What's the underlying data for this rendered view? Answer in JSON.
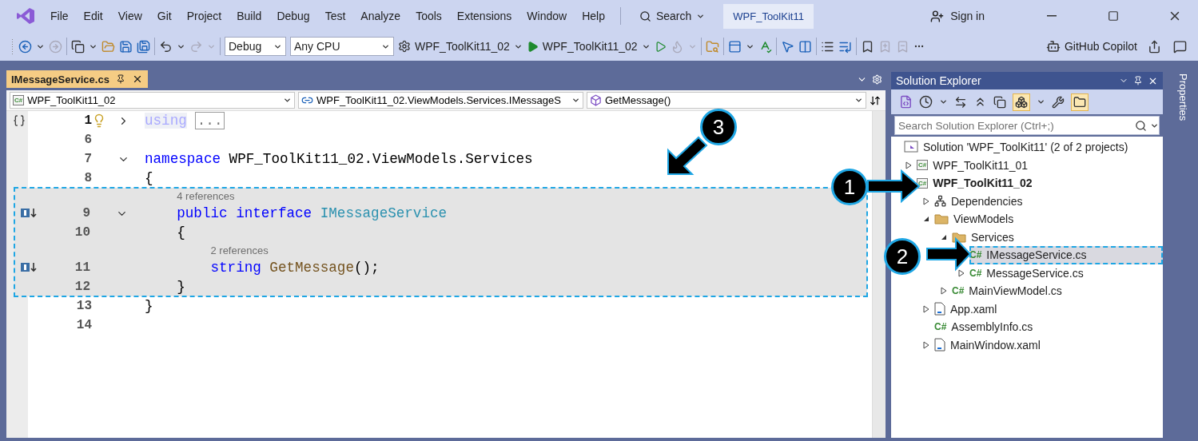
{
  "menu": {
    "items": [
      "File",
      "Edit",
      "View",
      "Git",
      "Project",
      "Build",
      "Debug",
      "Test",
      "Analyze",
      "Tools",
      "Extensions",
      "Window",
      "Help"
    ],
    "search": "Search",
    "solution_name": "WPF_ToolKit11",
    "sign_in": "Sign in"
  },
  "toolbar": {
    "configuration": "Debug",
    "platform": "Any CPU",
    "startup_project": "WPF_ToolKit11_02",
    "run_target": "WPF_ToolKit11_02",
    "copilot": "GitHub Copilot"
  },
  "editor": {
    "tabs": [
      {
        "label": "IMessageService.cs",
        "selected": true
      }
    ],
    "nav": [
      {
        "kind": "project",
        "icon_text": "C#",
        "label": "WPF_ToolKit11_02"
      },
      {
        "kind": "interface",
        "label": "WPF_ToolKit11_02.ViewModels.Services.IMessageS"
      },
      {
        "kind": "method",
        "label": "GetMessage()"
      }
    ],
    "lines": [
      {
        "kind": "code",
        "number": "1",
        "current": true,
        "highlight": false,
        "markers": [
          {
            "kind": "region"
          },
          {
            "kind": "bulb"
          },
          {
            "kind": "fold",
            "expanded": false
          }
        ],
        "tokens": [
          {
            "text": "using",
            "kind": "faded"
          },
          {
            "text": "...",
            "kind": "collapsed"
          }
        ]
      },
      {
        "kind": "code",
        "number": "6",
        "current": false,
        "highlight": false
      },
      {
        "kind": "code",
        "number": "7",
        "current": false,
        "highlight": false,
        "markers": [
          {
            "kind": "fold",
            "expanded": true
          }
        ],
        "tokens": [
          {
            "text": "namespace",
            "kind": "keyword"
          },
          {
            "text": " WPF_ToolKit11_02.ViewModels.Services",
            "kind": "plain"
          }
        ]
      },
      {
        "kind": "code",
        "number": "8",
        "current": false,
        "highlight": false,
        "tokens": [
          {
            "text": "{",
            "kind": "plain"
          }
        ]
      },
      {
        "kind": "refs",
        "text": "4 references",
        "highlight": true
      },
      {
        "kind": "code",
        "number": "9",
        "current": false,
        "highlight": true,
        "markers": [
          {
            "kind": "implements"
          },
          {
            "kind": "fold",
            "expanded": true
          }
        ],
        "tokens": [
          {
            "text": "    public interface",
            "kind": "keyword"
          },
          {
            "text": " IMessageService",
            "kind": "type"
          }
        ]
      },
      {
        "kind": "code",
        "number": "10",
        "current": false,
        "highlight": true,
        "tokens": [
          {
            "text": "    {",
            "kind": "plain"
          }
        ]
      },
      {
        "kind": "refs",
        "text": "2 references",
        "highlight": true
      },
      {
        "kind": "code",
        "number": "11",
        "current": false,
        "highlight": true,
        "markers": [
          {
            "kind": "implements"
          }
        ],
        "tokens": [
          {
            "text": "        string",
            "kind": "keyword"
          },
          {
            "text": " GetMessage",
            "kind": "method"
          },
          {
            "text": "();",
            "kind": "plain"
          }
        ]
      },
      {
        "kind": "code",
        "number": "12",
        "current": false,
        "highlight": true,
        "tokens": [
          {
            "text": "    }",
            "kind": "plain"
          }
        ]
      },
      {
        "kind": "code",
        "number": "13",
        "current": false,
        "highlight": false,
        "tokens": [
          {
            "text": "}",
            "kind": "plain"
          }
        ]
      },
      {
        "kind": "code",
        "number": "14",
        "current": false,
        "highlight": false
      }
    ]
  },
  "solution_explorer": {
    "title": "Solution Explorer",
    "search": {
      "placeholder": "Search Solution Explorer (Ctrl+;)"
    },
    "solution": {
      "label": "Solution 'WPF_ToolKit11' (2 of 2 projects)",
      "children": [
        {
          "label": "WPF_ToolKit11_01",
          "kind": "project",
          "icon_text": "C#",
          "expanded": false,
          "startup": false,
          "selected": false
        },
        {
          "label": "WPF_ToolKit11_02",
          "kind": "project",
          "icon_text": "C#",
          "startup": true,
          "selected": false,
          "children": [
            {
              "label": "Dependencies",
              "kind": "dependencies",
              "expanded": false,
              "startup": false,
              "selected": false
            },
            {
              "label": "ViewModels",
              "kind": "folder",
              "expanded": true,
              "startup": false,
              "selected": false,
              "children": [
                {
                  "label": "Services",
                  "kind": "folder",
                  "expanded": true,
                  "startup": false,
                  "selected": false,
                  "children": [
                    {
                      "label": "IMessageService.cs",
                      "kind": "file",
                      "icon_text": "C#",
                      "startup": false,
                      "selected": true
                    },
                    {
                      "label": "MessageService.cs",
                      "kind": "file",
                      "icon_text": "C#",
                      "expanded": false,
                      "startup": false,
                      "selected": false
                    }
                  ]
                },
                {
                  "label": "MainViewModel.cs",
                  "kind": "file",
                  "icon_text": "C#",
                  "expanded": false,
                  "startup": false,
                  "selected": false
                }
              ]
            },
            {
              "label": "App.xaml",
              "kind": "xaml",
              "expanded": false,
              "startup": false,
              "selected": false
            },
            {
              "label": "AssemblyInfo.cs",
              "kind": "file",
              "icon_text": "C#",
              "startup": false,
              "selected": false
            },
            {
              "label": "MainWindow.xaml",
              "kind": "xaml",
              "expanded": false,
              "startup": false,
              "selected": false
            }
          ]
        }
      ]
    }
  },
  "properties_tab": "Properties",
  "callouts": [
    {
      "label": "1"
    },
    {
      "label": "2"
    },
    {
      "label": "3"
    }
  ]
}
